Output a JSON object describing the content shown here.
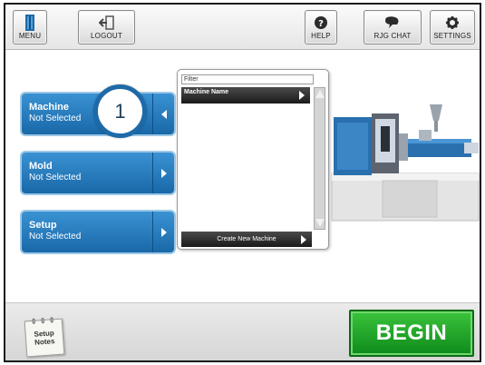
{
  "toolbar": {
    "menu_label": "MENU",
    "logout_label": "LOGOUT",
    "help_label": "HELP",
    "chat_label": "RJG CHAT",
    "settings_label": "SETTINGS"
  },
  "selectors": [
    {
      "title": "Machine",
      "status": "Not Selected",
      "expanded": true
    },
    {
      "title": "Mold",
      "status": "Not Selected",
      "expanded": false
    },
    {
      "title": "Setup",
      "status": "Not Selected",
      "expanded": false
    }
  ],
  "step_indicator": "1",
  "machine_dropdown": {
    "filter_placeholder": "Filter",
    "column_header": "Machine Name",
    "create_label": "Create New Machine"
  },
  "bottom": {
    "notes_label": "Setup\nNotes",
    "begin_label": "BEGIN"
  },
  "colors": {
    "selector_blue": "#1f78bd",
    "begin_green": "#1ea82b",
    "toolbar_bg": "#eeeeee"
  },
  "icons": {
    "menu": "menu-icon",
    "logout": "logout-icon",
    "help": "help-icon",
    "chat": "chat-icon",
    "settings": "gear-icon"
  }
}
